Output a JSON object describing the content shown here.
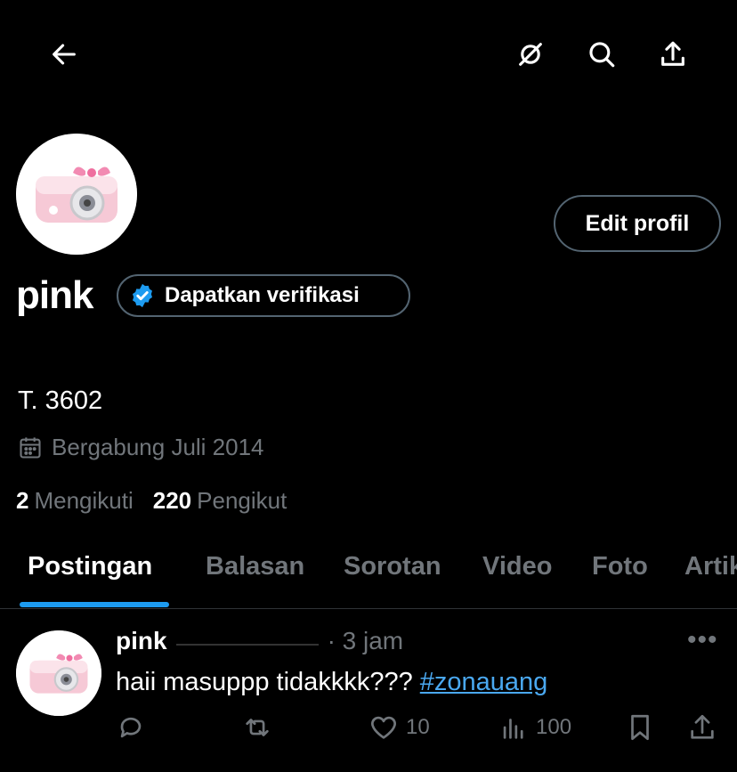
{
  "header": {
    "back_icon": "arrow-left-icon",
    "grok_icon": "grok-icon",
    "search_icon": "search-icon",
    "share_icon": "share-icon"
  },
  "profile": {
    "name": "pink",
    "edit_label": "Edit profil",
    "verify_label": "Dapatkan verifikasi",
    "bio": "T. 3602",
    "joined": "Bergabung Juli 2014",
    "following_count": "2",
    "following_label": "Mengikuti",
    "followers_count": "220",
    "followers_label": "Pengikut"
  },
  "tabs": [
    "Postingan",
    "Balasan",
    "Sorotan",
    "Video",
    "Foto",
    "Artik"
  ],
  "post": {
    "name": "pink",
    "time": "· 3 jam",
    "text": "haii masuppp tidakkkk??? ",
    "hashtag": "#zonauang",
    "likes": "10",
    "views": "100"
  },
  "colors": {
    "accent": "#1d9bf0",
    "verify_badge": "#1d9bf0",
    "muted": "#71767b"
  }
}
